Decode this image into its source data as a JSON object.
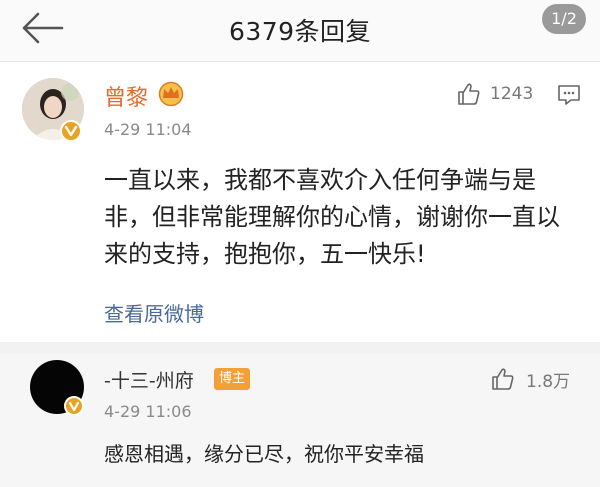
{
  "header": {
    "title": "6379条回复",
    "page_indicator": "1/2",
    "back_icon": "arrow-left-icon"
  },
  "post": {
    "author": "曾黎",
    "crown_icon": "crown-icon",
    "time": "4-29 11:04",
    "likes": "1243",
    "text": "一直以来，我都不喜欢介入任何争端与是非，但非常能理解你的心情，谢谢你一直以来的支持，抱抱你，五一快乐!",
    "view_original": "查看原微博"
  },
  "reply": {
    "author": "-十三-州府",
    "tag": "博主",
    "likes": "1.8万",
    "time": "4-29 11:06",
    "text": "感恩相遇，缘分已尽，祝你平安幸福"
  },
  "colors": {
    "author_name": "#e86a2a",
    "link": "#4a6a96",
    "verified_badge": "#e8a321",
    "blogger_tag": "#f3a03a"
  }
}
